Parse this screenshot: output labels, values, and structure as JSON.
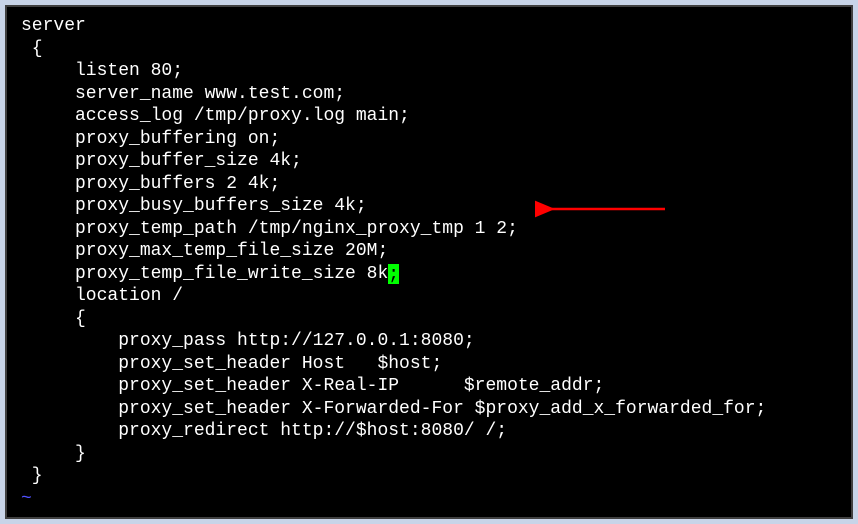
{
  "config": {
    "lines": [
      "server",
      " {",
      "     listen 80;",
      "     server_name www.test.com;",
      "     access_log /tmp/proxy.log main;",
      "     proxy_buffering on;",
      "     proxy_buffer_size 4k;",
      "     proxy_buffers 2 4k;",
      "     proxy_busy_buffers_size 4k;",
      "     proxy_temp_path /tmp/nginx_proxy_tmp 1 2;",
      "     proxy_max_temp_file_size 20M;",
      "     proxy_temp_file_write_size 8k"
    ],
    "cursor_char": ";",
    "lines_after": [
      "",
      "     location /",
      "     {",
      "         proxy_pass http://127.0.0.1:8080;",
      "         proxy_set_header Host   $host;",
      "         proxy_set_header X-Real-IP      $remote_addr;",
      "         proxy_set_header X-Forwarded-For $proxy_add_x_forwarded_for;",
      "         proxy_redirect http://$host:8080/ /;",
      "     }",
      "",
      " }"
    ],
    "tilde": "~"
  },
  "arrow": {
    "color": "#ff0000"
  }
}
